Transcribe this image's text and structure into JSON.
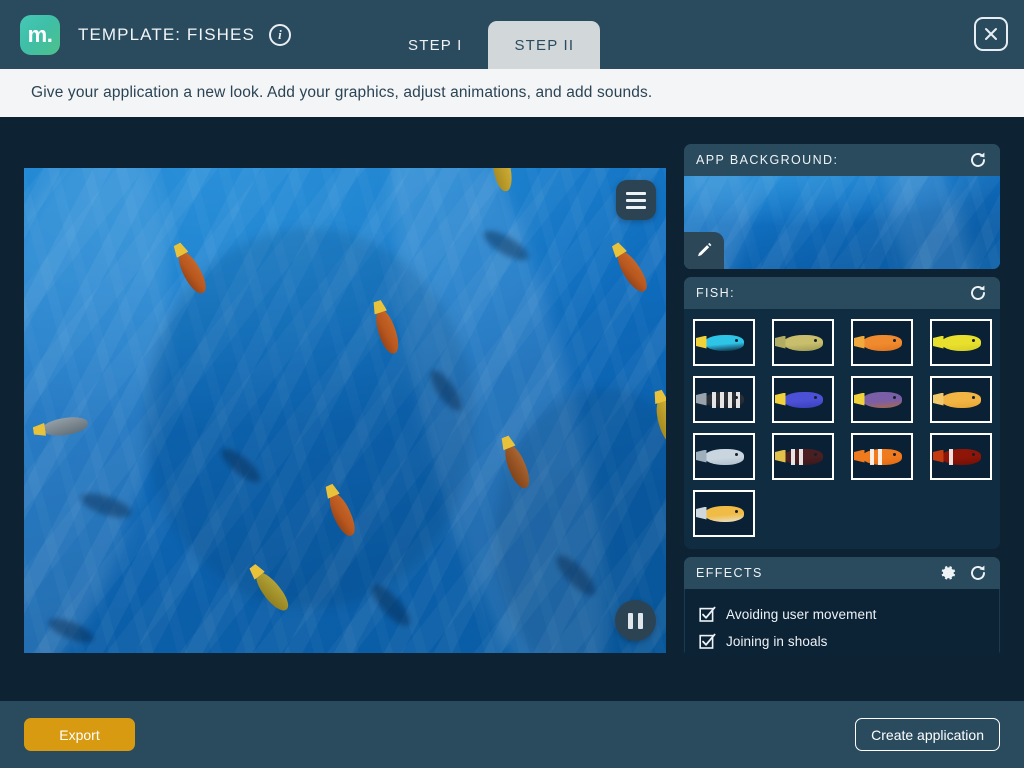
{
  "header": {
    "logo_text": "m.",
    "title": "TEMPLATE: FISHES",
    "info_icon": "info-icon",
    "close_icon": "close-icon",
    "tabs": [
      {
        "label": "STEP I",
        "active": false
      },
      {
        "label": "STEP II",
        "active": true
      }
    ]
  },
  "instruction": {
    "text": "Give your application a new look. Add your graphics, adjust animations, and add sounds."
  },
  "preview": {
    "menu_icon": "hamburger-menu-icon",
    "pause_icon": "pause-icon",
    "scene": "underwater-aquarium-preview"
  },
  "panels": {
    "app_background": {
      "title": "APP BACKGROUND:",
      "refresh_icon": "refresh-icon",
      "edit_icon": "pencil-edit-icon"
    },
    "fish": {
      "title": "FISH:",
      "refresh_icon": "refresh-icon",
      "items": [
        {
          "name": "blue-tang",
          "body": "#2ec4e8",
          "belly": "#0b2238",
          "tail": "#f2d23a",
          "stripes": 0
        },
        {
          "name": "olive-cichlid",
          "body": "#c8be6b",
          "belly": "#9d9a57",
          "tail": "#b3ad63",
          "stripes": 0
        },
        {
          "name": "orange-tang",
          "body": "#f08a2e",
          "belly": "#e07520",
          "tail": "#f0a93c",
          "stripes": 0
        },
        {
          "name": "yellow-tang",
          "body": "#e8e02c",
          "belly": "#d6cd26",
          "tail": "#e8e02c",
          "stripes": 0
        },
        {
          "name": "zebra-cichlid",
          "body": "#2a2f36",
          "belly": "#1d2128",
          "tail": "#9aa3ab",
          "stripes": 4
        },
        {
          "name": "blue-yellow-wrasse",
          "body": "#4b50d6",
          "belly": "#3a3fb8",
          "tail": "#f2d23a",
          "stripes": 0
        },
        {
          "name": "purple-brown-wrasse",
          "body": "#7b5ea8",
          "belly": "#a76a47",
          "tail": "#f2d23a",
          "stripes": 0
        },
        {
          "name": "golden-cichlid",
          "body": "#f2b544",
          "belly": "#e5a432",
          "tail": "#f2c96a",
          "stripes": 0
        },
        {
          "name": "silver-cichlid",
          "body": "#c9d6e0",
          "belly": "#aebecb",
          "tail": "#9fb0bd",
          "stripes": 0
        },
        {
          "name": "saddleback-clownfish",
          "body": "#4a1f22",
          "belly": "#3a181b",
          "tail": "#e2c049",
          "stripes": 2
        },
        {
          "name": "common-clownfish",
          "body": "#f07a1e",
          "belly": "#e06a14",
          "tail": "#f07a1e",
          "stripes": 2
        },
        {
          "name": "maroon-clownfish",
          "body": "#8e1508",
          "belly": "#6e1006",
          "tail": "#c43c10",
          "stripes": 1
        },
        {
          "name": "yellow-white-cichlid",
          "body": "#f0bc45",
          "belly": "#e8e2d4",
          "tail": "#cfd8de",
          "stripes": 0
        }
      ]
    },
    "effects": {
      "title": "EFFECTS",
      "settings_icon": "gear-icon",
      "refresh_icon": "refresh-icon",
      "items": [
        {
          "label": "Avoiding user movement",
          "checked": true
        },
        {
          "label": "Joining in shoals",
          "checked": true
        }
      ]
    }
  },
  "footer": {
    "export_label": "Export",
    "create_label": "Create application",
    "export_color": "#d79a10"
  }
}
